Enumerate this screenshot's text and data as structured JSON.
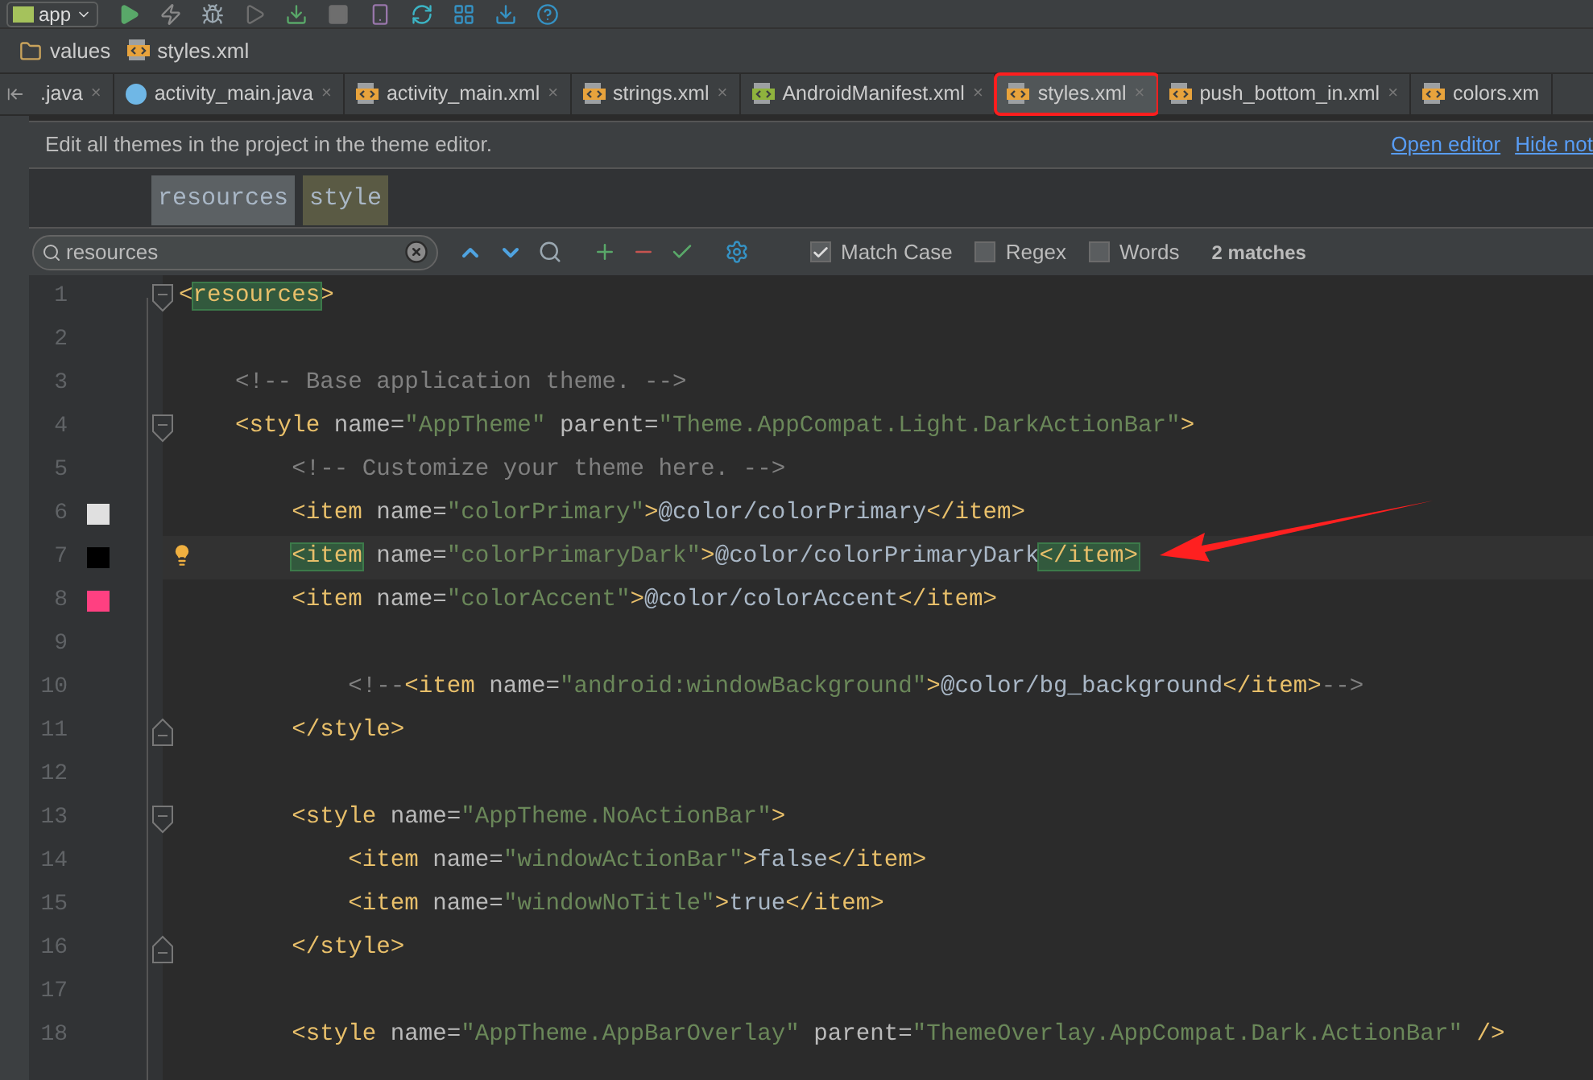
{
  "toolbar": {
    "run_config": "app"
  },
  "breadcrumb": [
    {
      "kind": "folder",
      "label": "values"
    },
    {
      "kind": "xml",
      "label": "styles.xml"
    }
  ],
  "tabs": [
    {
      "kind": "java",
      "label": ".java",
      "close": "×",
      "selected": false,
      "highlighted": false
    },
    {
      "kind": "class",
      "label": "activity_main.java",
      "close": "×",
      "selected": false,
      "highlighted": false
    },
    {
      "kind": "xml",
      "label": "activity_main.xml",
      "close": "×",
      "selected": false,
      "highlighted": false
    },
    {
      "kind": "xml",
      "label": "strings.xml",
      "close": "×",
      "selected": false,
      "highlighted": false
    },
    {
      "kind": "manifest",
      "label": "AndroidManifest.xml",
      "close": "×",
      "selected": false,
      "highlighted": false
    },
    {
      "kind": "xml",
      "label": "styles.xml",
      "close": "×",
      "selected": true,
      "highlighted": true
    },
    {
      "kind": "xml",
      "label": "push_bottom_in.xml",
      "close": "×",
      "selected": false,
      "highlighted": false
    },
    {
      "kind": "xml",
      "label": "colors.xm",
      "selected": false,
      "highlighted": false
    }
  ],
  "notification": {
    "message": "Edit all themes in the project in the theme editor.",
    "links": [
      "Open editor",
      "Hide not"
    ]
  },
  "tag_path": [
    {
      "label": "resources",
      "selected": false
    },
    {
      "label": "style",
      "selected": true
    }
  ],
  "search": {
    "value": "resources",
    "options": [
      {
        "label": "Match Case",
        "checked": true
      },
      {
        "label": "Regex",
        "checked": false
      },
      {
        "label": "Words",
        "checked": false
      }
    ],
    "result": "2 matches"
  },
  "editor": {
    "lines": [
      {
        "number": "1",
        "fold_start": true,
        "tokens": [
          {
            "kind": "tag",
            "text": "<"
          },
          {
            "kind": "tag",
            "text": "resources",
            "match": true
          },
          {
            "kind": "tag",
            "text": ">"
          }
        ]
      },
      {
        "number": "2"
      },
      {
        "number": "3",
        "tokens": [
          {
            "kind": "comment",
            "text": "    <!-- Base application theme. -->"
          }
        ]
      },
      {
        "number": "4",
        "fold_start": true,
        "tokens": [
          {
            "kind": "tag",
            "text": "    <style"
          },
          {
            "kind": "attr",
            "text": " name="
          },
          {
            "kind": "str",
            "text": "\"AppTheme\""
          },
          {
            "kind": "attr",
            "text": " parent="
          },
          {
            "kind": "str",
            "text": "\"Theme.AppCompat.Light.DarkActionBar\""
          },
          {
            "kind": "tag",
            "text": ">"
          }
        ]
      },
      {
        "number": "5",
        "tokens": [
          {
            "kind": "comment",
            "text": "        <!-- Customize your theme here. -->"
          }
        ]
      },
      {
        "number": "6",
        "color": "#e0e0e0",
        "tokens": [
          {
            "kind": "tag",
            "text": "        <item"
          },
          {
            "kind": "attr",
            "text": " name="
          },
          {
            "kind": "str",
            "text": "\"colorPrimary\""
          },
          {
            "kind": "tag",
            "text": ">"
          },
          {
            "kind": "text",
            "text": "@color/colorPrimary"
          },
          {
            "kind": "tag",
            "text": "</item>"
          }
        ]
      },
      {
        "number": "7",
        "color": "#000000",
        "current": true,
        "tokens": [
          {
            "kind": "tag",
            "text": "        <item",
            "match": true
          },
          {
            "kind": "attr",
            "text": " name="
          },
          {
            "kind": "str",
            "text": "\"colorPrimaryDark\""
          },
          {
            "kind": "tag",
            "text": ">"
          },
          {
            "kind": "text",
            "text": "@color/colorPrimaryDark"
          },
          {
            "kind": "tag",
            "text": "</item>",
            "match": true
          }
        ]
      },
      {
        "number": "8",
        "color": "#ff4081",
        "tokens": [
          {
            "kind": "tag",
            "text": "        <item"
          },
          {
            "kind": "attr",
            "text": " name="
          },
          {
            "kind": "str",
            "text": "\"colorAccent\""
          },
          {
            "kind": "tag",
            "text": ">"
          },
          {
            "kind": "text",
            "text": "@color/colorAccent"
          },
          {
            "kind": "tag",
            "text": "</item>"
          }
        ]
      },
      {
        "number": "9"
      },
      {
        "number": "10",
        "tokens": [
          {
            "kind": "comment",
            "text": "            <!--"
          },
          {
            "kind": "tag",
            "text": "<item"
          },
          {
            "kind": "attr",
            "text": " name="
          },
          {
            "kind": "str",
            "text": "\"android:windowBackground\""
          },
          {
            "kind": "tag",
            "text": ">"
          },
          {
            "kind": "text",
            "text": "@color/bg_background"
          },
          {
            "kind": "tag",
            "text": "</item>"
          },
          {
            "kind": "comment",
            "text": "-->"
          }
        ]
      },
      {
        "number": "11",
        "fold_end": true,
        "tokens": [
          {
            "kind": "tag",
            "text": "        </style>"
          }
        ]
      },
      {
        "number": "12"
      },
      {
        "number": "13",
        "fold_start": true,
        "tokens": [
          {
            "kind": "tag",
            "text": "        <style"
          },
          {
            "kind": "attr",
            "text": " name="
          },
          {
            "kind": "str",
            "text": "\"AppTheme.NoActionBar\""
          },
          {
            "kind": "tag",
            "text": ">"
          }
        ]
      },
      {
        "number": "14",
        "tokens": [
          {
            "kind": "tag",
            "text": "            <item"
          },
          {
            "kind": "attr",
            "text": " name="
          },
          {
            "kind": "str",
            "text": "\"windowActionBar\""
          },
          {
            "kind": "tag",
            "text": ">"
          },
          {
            "kind": "text",
            "text": "false"
          },
          {
            "kind": "tag",
            "text": "</item>"
          }
        ]
      },
      {
        "number": "15",
        "tokens": [
          {
            "kind": "tag",
            "text": "            <item"
          },
          {
            "kind": "attr",
            "text": " name="
          },
          {
            "kind": "str",
            "text": "\"windowNoTitle\""
          },
          {
            "kind": "tag",
            "text": ">"
          },
          {
            "kind": "text",
            "text": "true"
          },
          {
            "kind": "tag",
            "text": "</item>"
          }
        ]
      },
      {
        "number": "16",
        "fold_end": true,
        "tokens": [
          {
            "kind": "tag",
            "text": "        </style>"
          }
        ]
      },
      {
        "number": "17"
      },
      {
        "number": "18",
        "tokens": [
          {
            "kind": "tag",
            "text": "        <style"
          },
          {
            "kind": "attr",
            "text": " name="
          },
          {
            "kind": "str",
            "text": "\"AppTheme.AppBarOverlay\""
          },
          {
            "kind": "attr",
            "text": " parent="
          },
          {
            "kind": "str",
            "text": "\"ThemeOverlay.AppCompat.Dark.ActionBar\""
          },
          {
            "kind": "tag",
            "text": " />"
          }
        ]
      }
    ]
  }
}
